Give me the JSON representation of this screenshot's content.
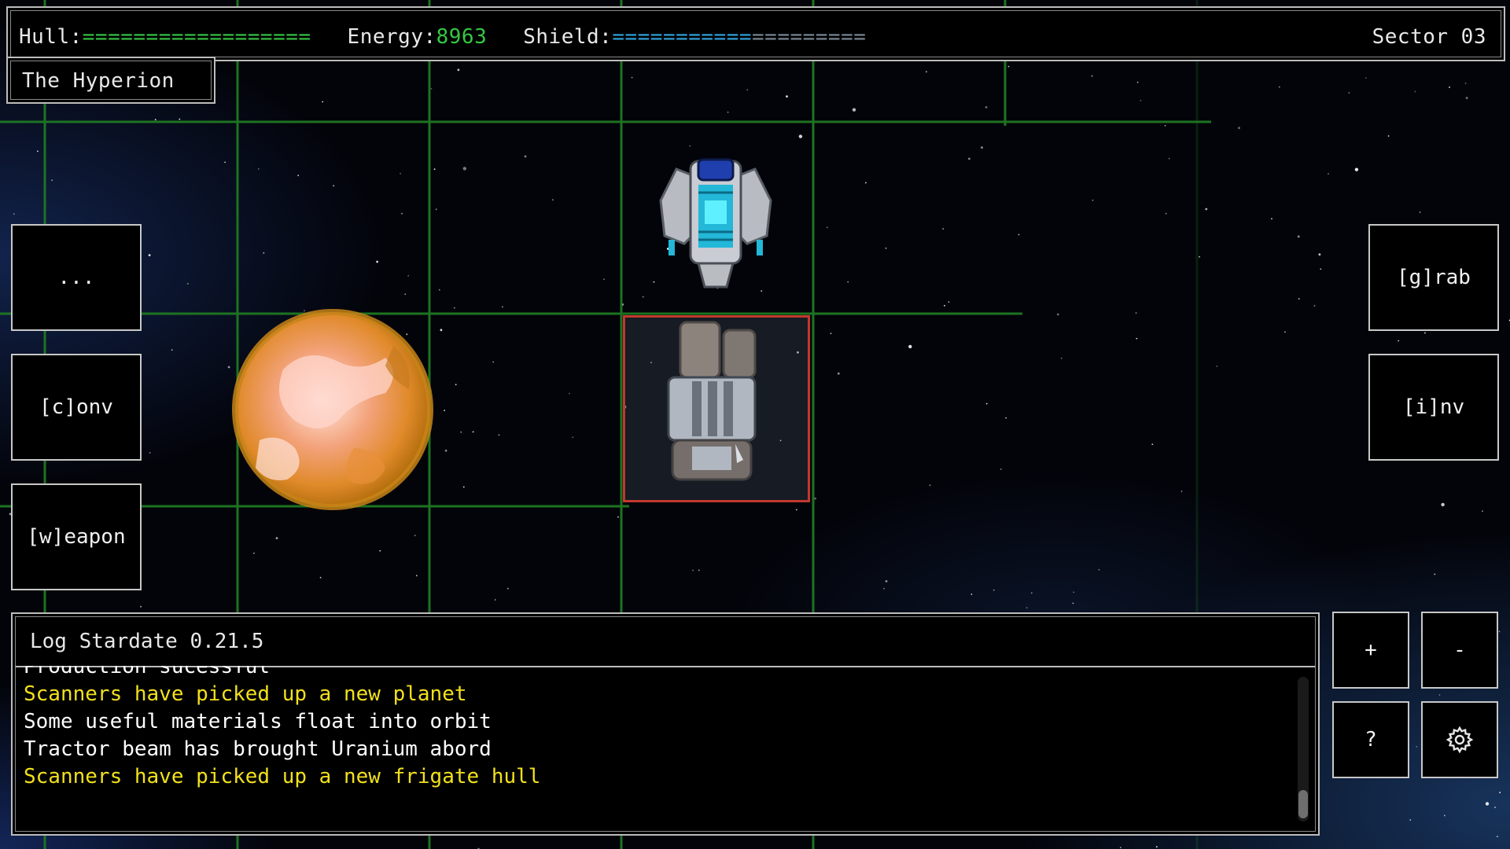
{
  "hud": {
    "hull_label": "Hull:",
    "hull_bar": "==================",
    "energy_label": "Energy:",
    "energy_value": "8963",
    "shield_label": "Shield:",
    "shield_bar_filled": "===========",
    "shield_bar_empty": "=========",
    "sector": "Sector 03",
    "ship_name": "The Hyperion"
  },
  "left_buttons": {
    "more": "...",
    "conv": "[c]onv",
    "weapon": "[w]eapon"
  },
  "right_buttons": {
    "grab": "[g]rab",
    "inv": "[i]nv"
  },
  "controls": {
    "zoom_in": "+",
    "zoom_out": "-",
    "help": "?"
  },
  "log": {
    "title": "Log Stardate 0.21.5",
    "lines": [
      {
        "text": "Production sucessful",
        "color": "#ffffff"
      },
      {
        "text": "Scanners have picked up a new planet",
        "color": "#f2e01d"
      },
      {
        "text": "Some useful materials float into orbit",
        "color": "#ffffff"
      },
      {
        "text": "Tractor beam has brought Uranium abord",
        "color": "#ffffff"
      },
      {
        "text": "Scanners have picked up a new frigate hull",
        "color": "#f2e01d"
      }
    ]
  },
  "colors": {
    "hull_bar": "#35c742",
    "energy_value": "#35c742",
    "shield_filled": "#2fa6e0",
    "shield_empty": "#7a8a99",
    "grid_line": "#1f7a22",
    "selection_border": "#c0392b"
  },
  "icons": {
    "settings": "gear-icon",
    "player_ship": "cruiser-ship-sprite",
    "derelict": "frigate-hull-sprite",
    "planet": "orange-planet-sprite"
  }
}
